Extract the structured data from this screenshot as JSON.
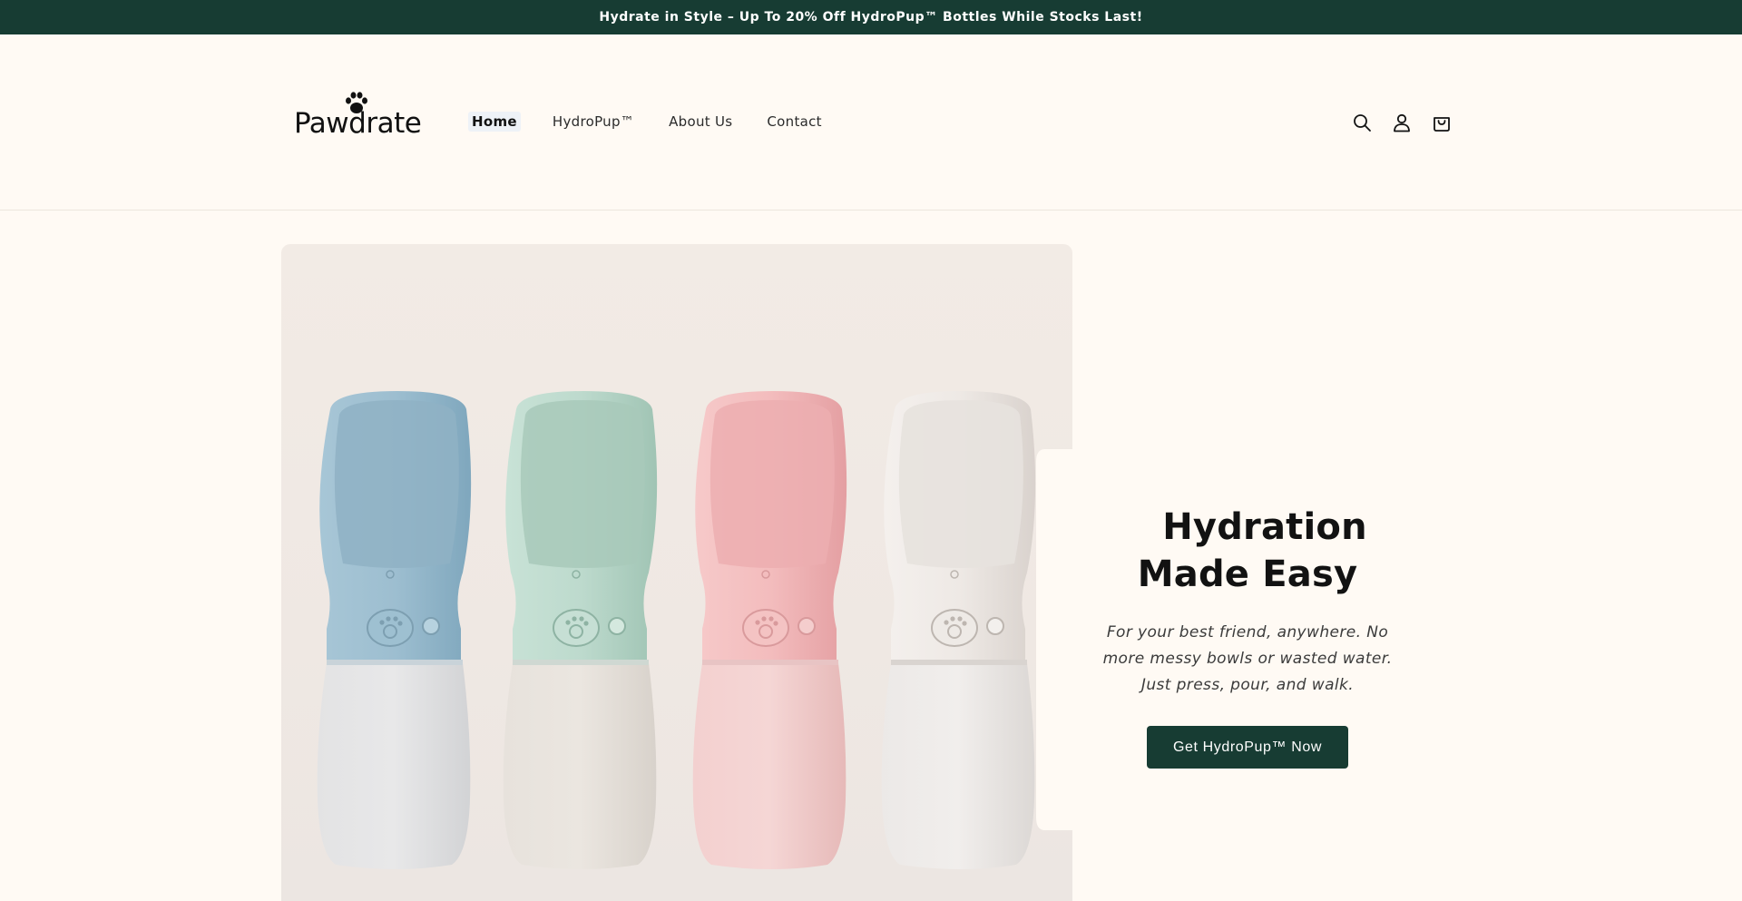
{
  "announcement": {
    "text": "Hydrate in Style – Up To 20% Off HydroPup™ Bottles While Stocks Last!"
  },
  "header": {
    "logo_text": "Pawdrate",
    "nav": [
      {
        "label": "Home",
        "active": true
      },
      {
        "label": "HydroPup™",
        "active": false
      },
      {
        "label": "About Us",
        "active": false
      },
      {
        "label": "Contact",
        "active": false
      }
    ],
    "icons": [
      "search-icon",
      "account-icon",
      "cart-icon"
    ]
  },
  "hero": {
    "heading_line1": "Hydration",
    "heading_line2": "Made Easy",
    "subtext": "For your best friend, anywhere. No more messy bowls or wasted water. Just press, pour, and walk.",
    "button_label": "Get HydroPup™ Now",
    "image_alt": "four-hydropup-bottles-image",
    "bottle_colors": [
      "#8fb6c9",
      "#b9d8cb",
      "#f1b9ba",
      "#ece8e4"
    ]
  },
  "colors": {
    "announcement_bg": "#173c33",
    "page_bg": "#fffaf4",
    "button_bg": "#173c33"
  }
}
